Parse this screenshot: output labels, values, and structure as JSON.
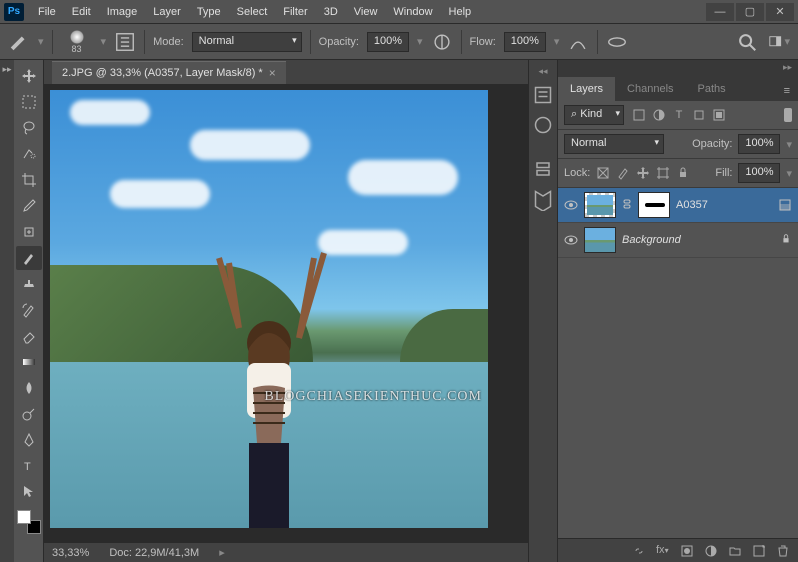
{
  "app": {
    "logo": "Ps"
  },
  "menu": [
    "File",
    "Edit",
    "Image",
    "Layer",
    "Type",
    "Select",
    "Filter",
    "3D",
    "View",
    "Window",
    "Help"
  ],
  "options": {
    "brush_size": "83",
    "mode_label": "Mode:",
    "mode_value": "Normal",
    "opacity_label": "Opacity:",
    "opacity_value": "100%",
    "flow_label": "Flow:",
    "flow_value": "100%"
  },
  "document": {
    "tab_title": "2.JPG @ 33,3% (A0357, Layer Mask/8) *",
    "zoom": "33,33%",
    "doc_info": "Doc: 22,9M/41,3M",
    "watermark": "BLOGCHIASEKIENTHUC.COM"
  },
  "layers_panel": {
    "tabs": [
      "Layers",
      "Channels",
      "Paths"
    ],
    "filter_kind_label": "Kind",
    "blend_mode": "Normal",
    "opacity_label": "Opacity:",
    "opacity_value": "100%",
    "lock_label": "Lock:",
    "fill_label": "Fill:",
    "fill_value": "100%",
    "layers": [
      {
        "name": "A0357",
        "visible": true,
        "has_mask": true,
        "locked": false,
        "active": true
      },
      {
        "name": "Background",
        "visible": true,
        "has_mask": false,
        "locked": true,
        "active": false,
        "italic": true
      }
    ],
    "filter_search_symbol": "⌕"
  }
}
